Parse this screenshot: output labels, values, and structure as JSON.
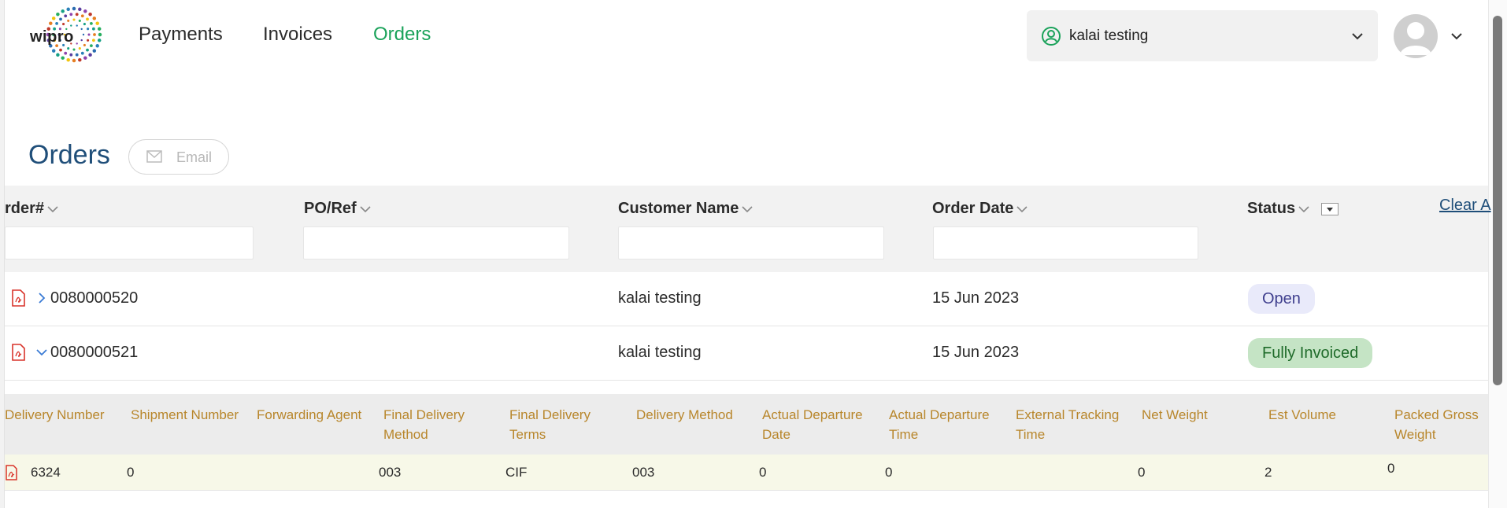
{
  "header": {
    "logo_text": "wipro",
    "nav": [
      {
        "label": "Payments",
        "active": false
      },
      {
        "label": "Invoices",
        "active": false
      },
      {
        "label": "Orders",
        "active": true
      }
    ],
    "account_selector": {
      "label": "kalai testing",
      "icon": "user-circle-icon"
    },
    "avatar_icon": "user-avatar-icon"
  },
  "page": {
    "title": "Orders",
    "email_button": {
      "label": "Email",
      "icon": "mail-icon"
    }
  },
  "table": {
    "columns": [
      "rder#",
      "PO/Ref",
      "Customer Name",
      "Order Date",
      "Status"
    ],
    "clear_link": "Clear A",
    "rows": [
      {
        "order": "0080000520",
        "po": "",
        "customer": "kalai testing",
        "date": "15 Jun 2023",
        "status": "Open",
        "expanded": false
      },
      {
        "order": "0080000521",
        "po": "",
        "customer": "kalai testing",
        "date": "15 Jun 2023",
        "status": "Fully Invoiced",
        "expanded": true
      }
    ]
  },
  "deliveries": {
    "columns": [
      "Delivery Number",
      "Shipment Number",
      "Forwarding Agent",
      "Final Delivery Method",
      "Final Delivery Terms",
      "Delivery Method",
      "Actual Departure Date",
      "Actual Departure Time",
      "External Tracking Time",
      "Net Weight",
      "Est Volume",
      "Packed Gross Weight"
    ],
    "rows": [
      {
        "delivery_number": "6324",
        "shipment_number": "0",
        "forwarding_agent": "",
        "final_delivery_method": "003",
        "final_delivery_terms": "CIF",
        "delivery_method": "003",
        "actual_departure_date": "0",
        "actual_departure_time": "0",
        "external_tracking_time": "",
        "net_weight": "0",
        "est_volume": "2",
        "packed_gross_weight": "0"
      }
    ]
  },
  "colors": {
    "accent_green": "#1aa25a",
    "title_blue": "#1f4e79",
    "delivery_header_text": "#b8862b",
    "pdf_red": "#d9342b"
  }
}
